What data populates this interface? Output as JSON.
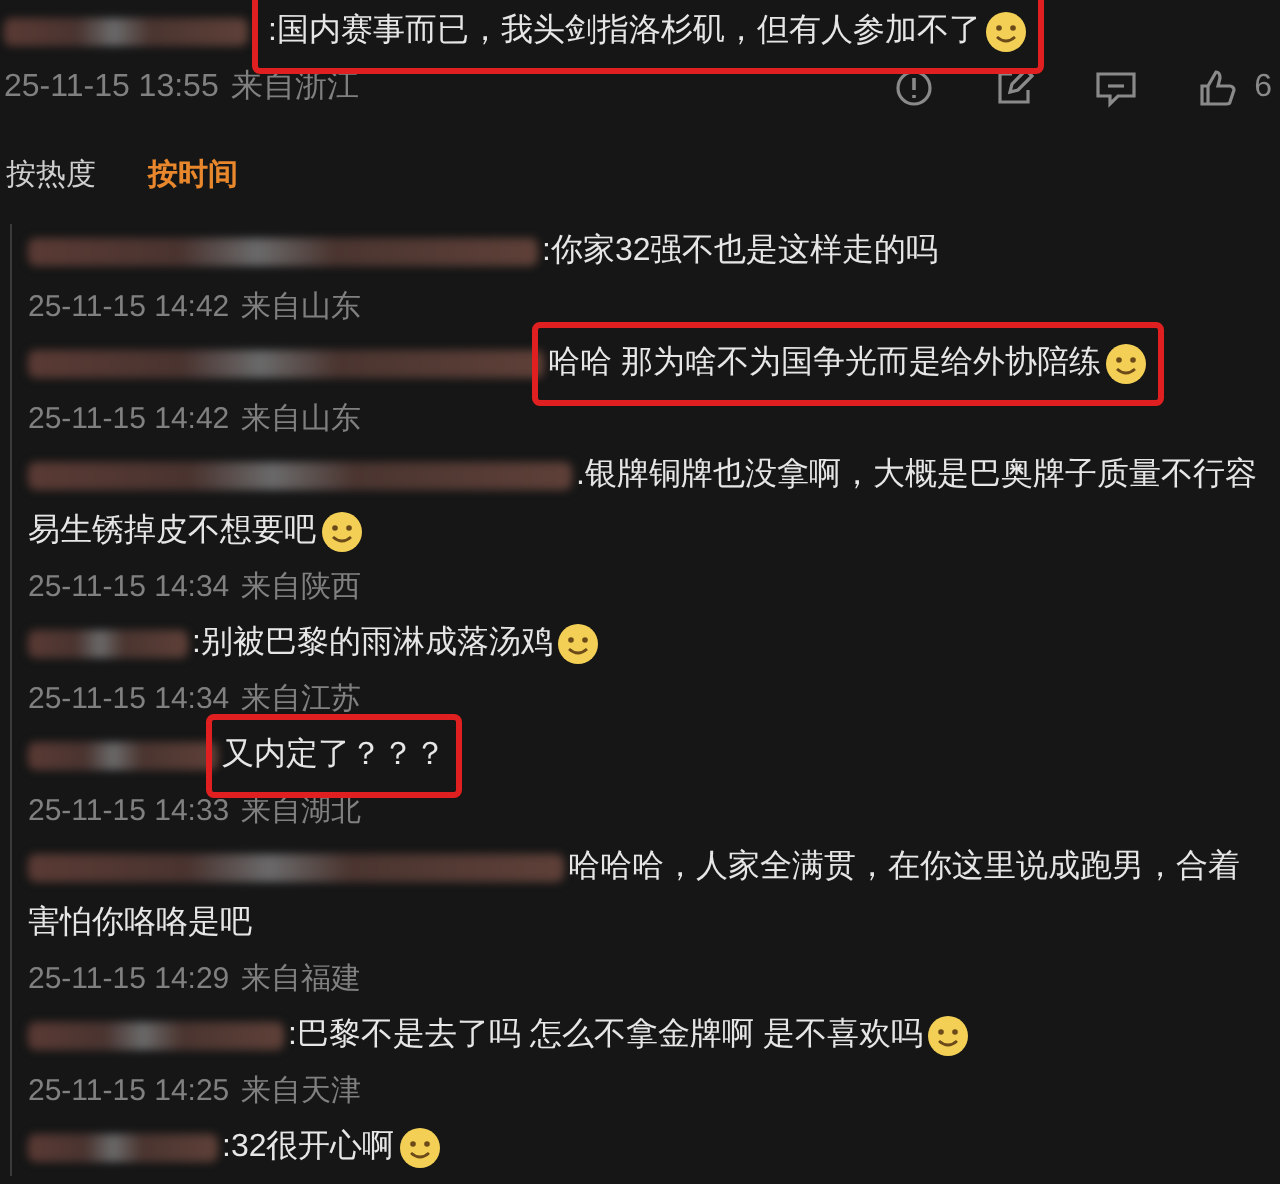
{
  "top_comment": {
    "lines": [
      ":国内赛事而已，我头剑指洛杉矶，但有人参加不了"
    ],
    "emoji": true,
    "highlighted": true,
    "time": "25-11-15 13:55",
    "location": "来自浙江",
    "like_count": "6"
  },
  "sort_tabs": [
    {
      "label": "按热度",
      "selected": false
    },
    {
      "label": "按时间",
      "selected": true
    }
  ],
  "replies": [
    {
      "lines": [
        ":你家32强不也是这样走的吗"
      ],
      "emoji": false,
      "highlighted": false,
      "time": "25-11-15 14:42",
      "location": "来自山东"
    },
    {
      "lines": [
        "哈哈 那为啥不为国争光而是给外协陪练"
      ],
      "emoji": true,
      "highlighted": true,
      "time": "25-11-15 14:42",
      "location": "来自山东"
    },
    {
      "lines": [
        ".银牌铜牌也没拿啊，大概是巴奥牌子质量不行容",
        "易生锈掉皮不想要吧"
      ],
      "emoji": true,
      "highlighted": false,
      "time": "25-11-15 14:34",
      "location": "来自陕西"
    },
    {
      "lines": [
        ":别被巴黎的雨淋成落汤鸡"
      ],
      "emoji": true,
      "highlighted": false,
      "time": "25-11-15 14:34",
      "location": "来自江苏"
    },
    {
      "lines": [
        "又内定了？？？"
      ],
      "emoji": false,
      "highlighted": true,
      "time": "25-11-15 14:33",
      "location": "来自湖北"
    },
    {
      "lines": [
        "哈哈哈，人家全满贯，在你这里说成跑男，合着",
        "害怕你咯咯是吧"
      ],
      "emoji": false,
      "highlighted": false,
      "time": "25-11-15 14:29",
      "location": "来自福建"
    },
    {
      "lines": [
        ":巴黎不是去了吗 怎么不拿金牌啊 是不喜欢吗"
      ],
      "emoji": true,
      "highlighted": false,
      "time": "25-11-15 14:25",
      "location": "来自天津"
    },
    {
      "lines": [
        ":32很开心啊"
      ],
      "emoji": true,
      "highlighted": false
    }
  ]
}
